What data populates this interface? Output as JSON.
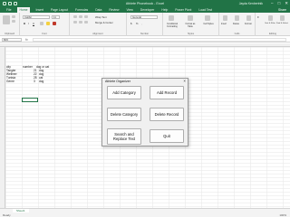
{
  "window": {
    "title": "Athlete Phonebook - Excel",
    "user": "Jayda Kenbertnik"
  },
  "menu": {
    "tabs": [
      "File",
      "Home",
      "Insert",
      "Page Layout",
      "Formulas",
      "Data",
      "Review",
      "View",
      "Developer",
      "Help",
      "Power Pivot",
      "Load Test"
    ],
    "active_index": 1,
    "share_label": "Share"
  },
  "ribbon": {
    "font_name": "Calibri",
    "font_size": "11",
    "number_format": "General",
    "wrap_text": "Wrap Text",
    "merge_center": "Merge & Center",
    "group_labels": [
      "Clipboard",
      "Font",
      "Alignment",
      "Number",
      "Styles",
      "Cells",
      "Editing"
    ],
    "styles": [
      "Conditional Formatting",
      "Format as Table",
      "Cell Styles"
    ],
    "cells": [
      "Insert",
      "Delete",
      "Format"
    ],
    "editing": [
      "Sort & Filter",
      "Find & Select"
    ]
  },
  "formula_bar": {
    "name_box": "B15",
    "fx_label": "fx"
  },
  "sheet": {
    "headers": [
      "city",
      "number",
      "dog or cat"
    ],
    "rows": [
      {
        "name": "",
        "city": "Tangier",
        "number": "21",
        "pet": "dog"
      },
      {
        "name": "",
        "city": "Wellmer",
        "number": "22",
        "pet": "dog"
      },
      {
        "name": "",
        "city": "Tunisia",
        "number": "28",
        "pet": "cat"
      },
      {
        "name": "",
        "city": "Genre",
        "number": "3",
        "pet": "dog"
      }
    ],
    "tab_name": "Sheet1"
  },
  "status": {
    "ready": "Ready",
    "zoom": "100%"
  },
  "dialog": {
    "title": "Athlete Organizer",
    "buttons": {
      "add_category": "Add Category",
      "add_record": "Add Record",
      "delete_category": "Delete Category",
      "delete_record": "Delete Record",
      "search_replace": "Search and Replace Text",
      "quit": "Quit"
    }
  }
}
